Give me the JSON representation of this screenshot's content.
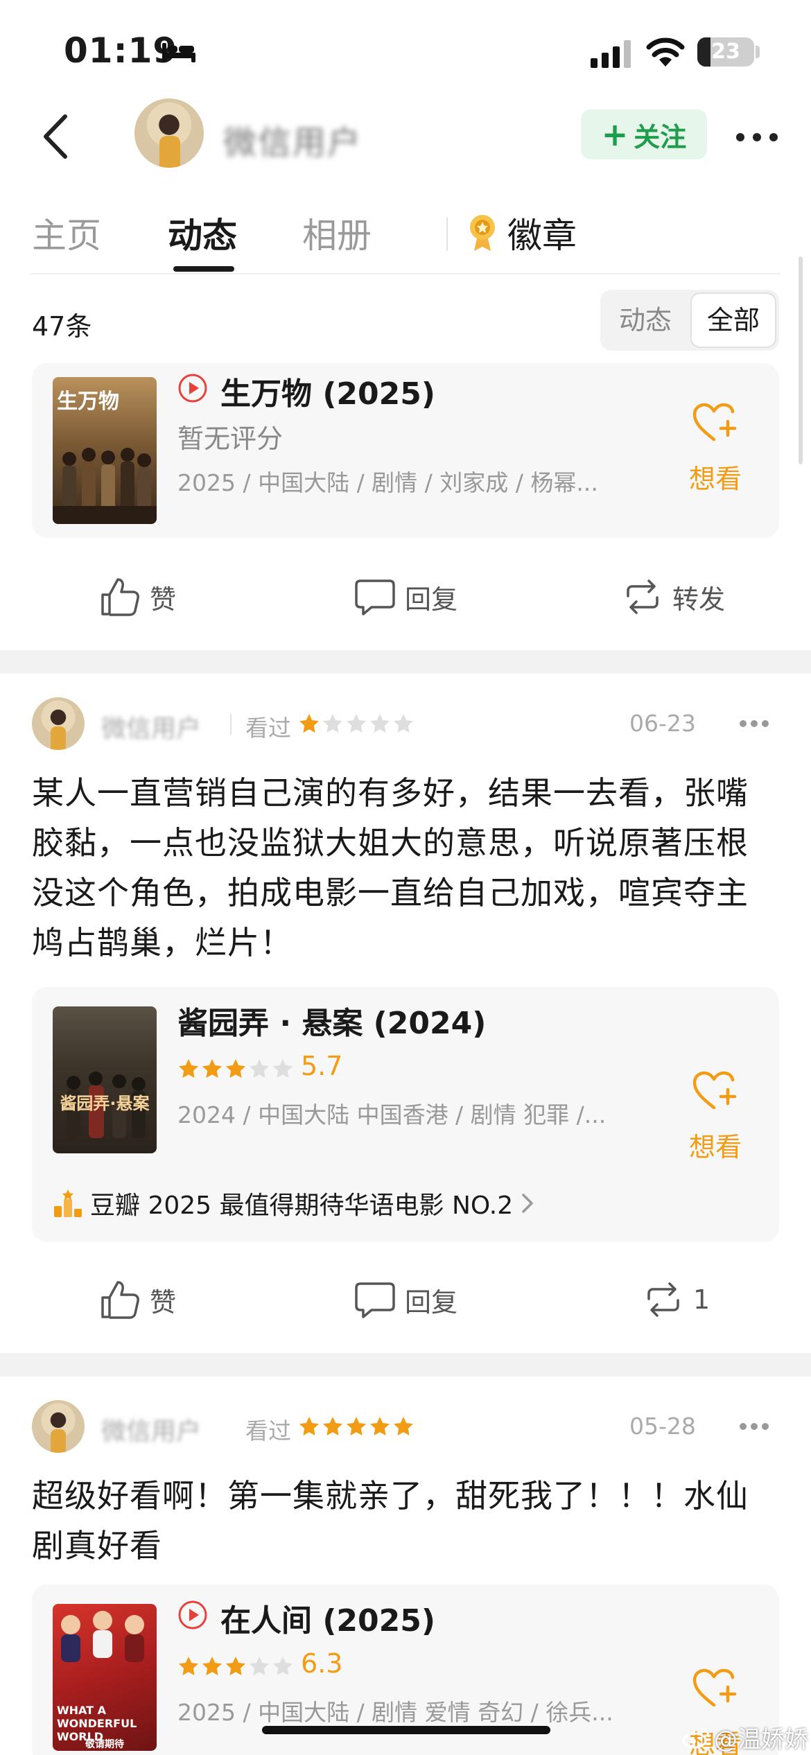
{
  "status_bar": {
    "time": "01:19",
    "battery": "23",
    "battery_level": 0.23
  },
  "header": {
    "username": "微信用户",
    "follow_label": "关注"
  },
  "tabs": [
    {
      "label": "主页"
    },
    {
      "label": "动态"
    },
    {
      "label": "相册"
    },
    {
      "label": "徽章"
    }
  ],
  "filter": {
    "count": "47条",
    "options": [
      "动态",
      "全部"
    ],
    "selected": "全部"
  },
  "colors": {
    "accent": "#f29b14",
    "follow_green": "#1f9d4d",
    "play_red": "#e8413c"
  },
  "cards": [
    {
      "title": "生万物 (2025)",
      "rating_text": "暂无评分",
      "meta": "2025 / 中国大陆 / 剧情 / 刘家成 / 杨幂...",
      "want_label": "想看",
      "poster_caption": "生万物"
    },
    {
      "title": "酱园弄 · 悬案 (2024)",
      "stars": 3,
      "score": "5.7",
      "meta": "2024 / 中国大陆 中国香港 / 剧情 犯罪 /...",
      "want_label": "想看",
      "rank": "豆瓣 2025 最值得期待华语电影 NO.2",
      "poster_caption": "酱园弄·悬案"
    },
    {
      "title": "在人间 (2025)",
      "stars": 3,
      "score": "6.3",
      "meta": "2025 / 中国大陆 / 剧情 爱情 奇幻 / 徐兵...",
      "want_label": "想看",
      "poster_caption": "WHAT A WONDERFUL WORLD",
      "poster_sub": "敬请期待"
    }
  ],
  "actions": [
    {
      "like": "赞",
      "reply": "回复",
      "repost": "转发"
    },
    {
      "like": "赞",
      "reply": "回复",
      "repost": "1"
    }
  ],
  "posts": [
    {
      "user": "微信用户",
      "status": "看过",
      "stars": 1,
      "date": "06-23",
      "body": "某人一直营销自己演的有多好，结果一去看，张嘴胶黏，一点也没监狱大姐大的意思，听说原著压根没这个角色，拍成电影一直给自己加戏，喧宾夺主鸠占鹊巢，烂片！"
    },
    {
      "user": "微信用户",
      "status": "看过",
      "stars": 5,
      "date": "05-28",
      "body": "超级好看啊！第一集就亲了，甜死我了！！！水仙剧真好看"
    }
  ],
  "watermark": "@温娇娇"
}
